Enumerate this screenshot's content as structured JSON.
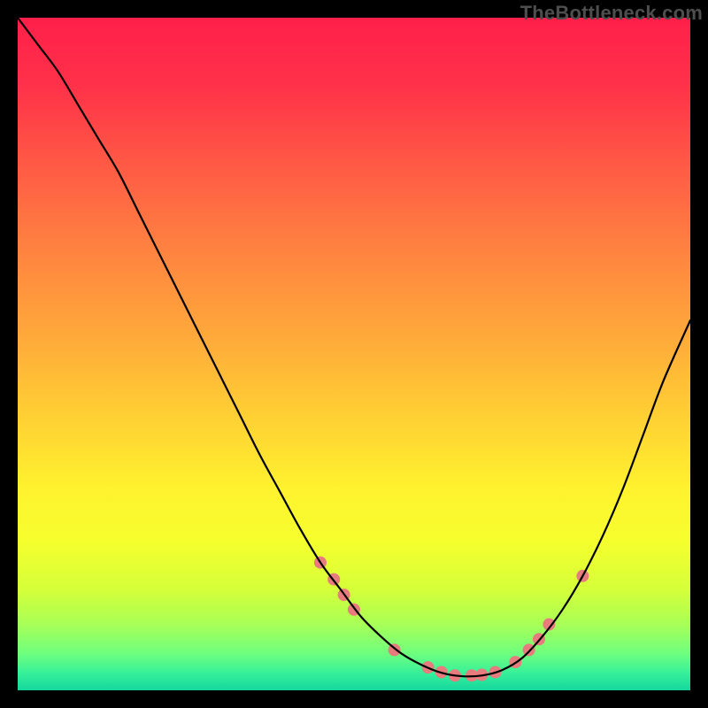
{
  "watermark": "TheBottleneck.com",
  "chart_data": {
    "type": "line",
    "title": "",
    "xlabel": "",
    "ylabel": "",
    "xlim": [
      0,
      100
    ],
    "ylim": [
      0,
      100
    ],
    "grid": false,
    "legend": false,
    "series": [
      {
        "name": "curve",
        "x": [
          0,
          3,
          6,
          9,
          12,
          15,
          18,
          21,
          24,
          27,
          30,
          33,
          36,
          39,
          42,
          45,
          48,
          51,
          54,
          57,
          60,
          63,
          66,
          69,
          72,
          75,
          78,
          81,
          84,
          87,
          90,
          93,
          96,
          100
        ],
        "y": [
          100,
          96,
          92,
          87,
          82,
          77,
          71,
          65,
          59,
          53,
          47,
          41,
          35,
          29.5,
          24,
          19,
          15,
          11,
          8,
          5.5,
          3.8,
          2.6,
          2.1,
          2.2,
          3,
          4.8,
          8,
          12,
          17,
          23,
          30,
          38,
          46,
          55
        ]
      }
    ],
    "markers": {
      "color": "#e77b7d",
      "radius": 7,
      "points": [
        {
          "x": 45,
          "y": 19
        },
        {
          "x": 47,
          "y": 16.5
        },
        {
          "x": 48.5,
          "y": 14.2
        },
        {
          "x": 50,
          "y": 12
        },
        {
          "x": 56,
          "y": 6
        },
        {
          "x": 61,
          "y": 3.4
        },
        {
          "x": 63,
          "y": 2.7
        },
        {
          "x": 65,
          "y": 2.2
        },
        {
          "x": 67.5,
          "y": 2.2
        },
        {
          "x": 69,
          "y": 2.3
        },
        {
          "x": 71,
          "y": 2.7
        },
        {
          "x": 74,
          "y": 4.2
        },
        {
          "x": 76,
          "y": 6
        },
        {
          "x": 77.5,
          "y": 7.6
        },
        {
          "x": 79,
          "y": 9.8
        },
        {
          "x": 84,
          "y": 17
        }
      ]
    },
    "gradient_stops": [
      {
        "offset": 0.0,
        "color": "#ff1f4a"
      },
      {
        "offset": 0.1,
        "color": "#ff3149"
      },
      {
        "offset": 0.22,
        "color": "#ff5a45"
      },
      {
        "offset": 0.35,
        "color": "#ff8440"
      },
      {
        "offset": 0.48,
        "color": "#ffab3a"
      },
      {
        "offset": 0.6,
        "color": "#ffd233"
      },
      {
        "offset": 0.7,
        "color": "#fff22e"
      },
      {
        "offset": 0.78,
        "color": "#f5ff2e"
      },
      {
        "offset": 0.85,
        "color": "#d5ff39"
      },
      {
        "offset": 0.9,
        "color": "#aaff55"
      },
      {
        "offset": 0.945,
        "color": "#6fff7e"
      },
      {
        "offset": 0.975,
        "color": "#35f09a"
      },
      {
        "offset": 1.0,
        "color": "#15d79d"
      }
    ]
  }
}
